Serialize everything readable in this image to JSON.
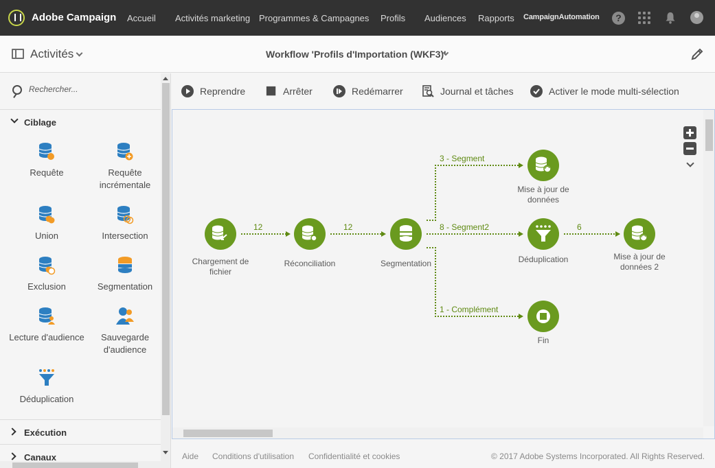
{
  "topnav": {
    "brand": "Adobe Campaign",
    "items": [
      "Accueil",
      "Activités marketing",
      "Programmes & Campagnes",
      "Profils",
      "Audiences",
      "Rapports"
    ],
    "user": "CampaignAutomation",
    "help": "?"
  },
  "header": {
    "activities_label": "Activités",
    "workflow_title": "Workflow 'Profils d'Importation (WKF3)'"
  },
  "sidebar": {
    "search_placeholder": "Rechercher...",
    "sections": {
      "ciblage": "Ciblage",
      "execution": "Exécution",
      "canaux": "Canaux"
    },
    "activities": [
      {
        "label": "Requête",
        "icon": "query-icon"
      },
      {
        "label": "Requête incrémentale",
        "icon": "incremental-query-icon"
      },
      {
        "label": "Union",
        "icon": "union-icon"
      },
      {
        "label": "Intersection",
        "icon": "intersection-icon"
      },
      {
        "label": "Exclusion",
        "icon": "exclusion-icon"
      },
      {
        "label": "Segmentation",
        "icon": "segmentation-icon"
      },
      {
        "label": "Lecture d'audience",
        "icon": "read-audience-icon"
      },
      {
        "label": "Sauvegarde d'audience",
        "icon": "save-audience-icon"
      },
      {
        "label": "Déduplication",
        "icon": "deduplication-icon"
      }
    ]
  },
  "toolbar": {
    "resume": "Reprendre",
    "stop": "Arrêter",
    "restart": "Redémarrer",
    "log": "Journal et tâches",
    "multiselect": "Activer le mode multi-sélection"
  },
  "workflow": {
    "nodes": {
      "load_file": "Chargement de fichier",
      "reconciliation": "Réconciliation",
      "segmentation": "Segmentation",
      "update_data": "Mise à jour de données",
      "deduplication": "Déduplication",
      "update_data_2": "Mise à jour de données 2",
      "end": "Fin"
    },
    "transitions": {
      "t1": "12",
      "t2": "12",
      "seg3": "3 - Segment",
      "seg8": "8 - Segment2",
      "comp": "1 - Complément",
      "dedup_out": "6"
    }
  },
  "footer": {
    "help": "Aide",
    "terms": "Conditions d'utilisation",
    "privacy": "Confidentialité et cookies",
    "copyright": "© 2017 Adobe Systems Incorporated. All Rights Reserved."
  },
  "colors": {
    "node_green": "#6a9a1f",
    "transition_green": "#5f8a12",
    "icon_blue": "#2d7fc1",
    "icon_orange": "#f29b26",
    "topnav": "#323232"
  }
}
